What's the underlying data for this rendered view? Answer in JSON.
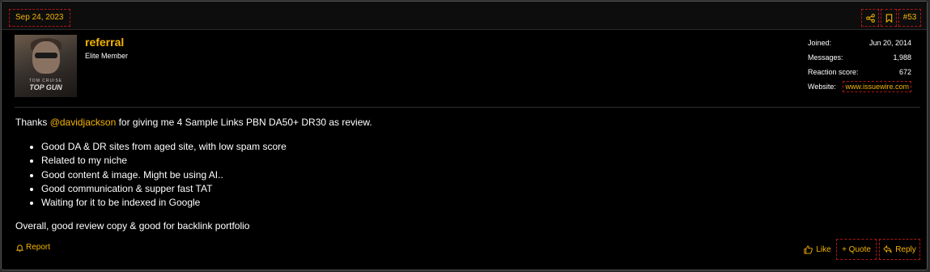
{
  "post": {
    "date": "Sep 24, 2023",
    "number": "#53",
    "share_icon": "share-icon",
    "bookmark_icon": "bookmark-icon"
  },
  "user": {
    "name": "referral",
    "title": "Elite Member",
    "avatar_text_top": "TOM CRUISE",
    "avatar_text_logo": "TOP GUN",
    "stats": [
      {
        "key": "Joined:",
        "value": "Jun 20, 2014"
      },
      {
        "key": "Messages:",
        "value": "1,988"
      },
      {
        "key": "Reaction score:",
        "value": "672"
      },
      {
        "key": "Website:",
        "value": "www.issuewire.com"
      }
    ]
  },
  "content": {
    "intro_before": "Thanks ",
    "mention": "@davidjackson",
    "intro_after": " for giving me 4 Sample Links PBN DA50+ DR30 as review.",
    "bullets": [
      "Good DA & DR sites from aged site, with low spam score",
      "Related to my niche",
      "Good content & image. Might be using AI..",
      "Good communication & supper fast TAT",
      "Waiting for it to be indexed in Google"
    ],
    "conclusion": "Overall, good review copy & good for backlink portfolio"
  },
  "actions": {
    "report": "Report",
    "like": "Like",
    "quote": "+ Quote",
    "reply": "Reply"
  },
  "colors": {
    "accent": "#f5b400",
    "outline": "#b01515",
    "background": "#000000"
  }
}
